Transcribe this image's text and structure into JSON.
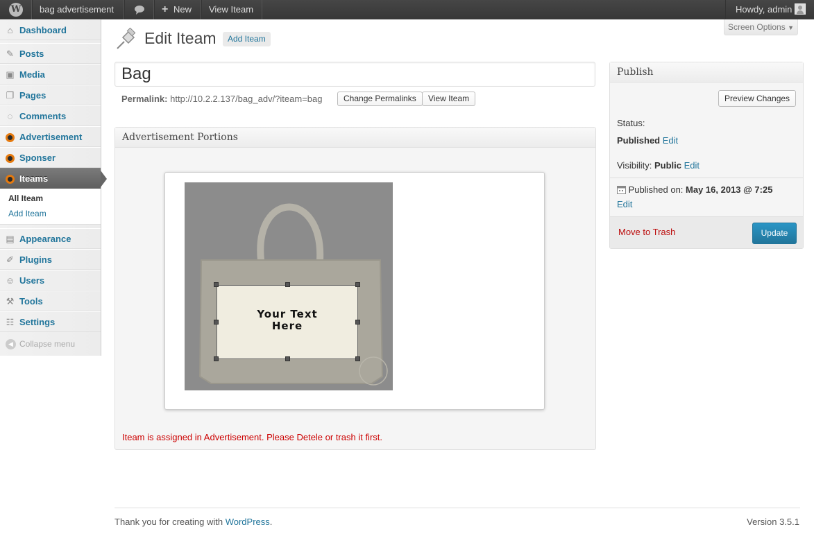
{
  "adminbar": {
    "site_name": "bag advertisement",
    "new_label": "New",
    "view_label": "View Iteam",
    "howdy": "Howdy, admin"
  },
  "sidebar": {
    "items": [
      {
        "label": "Dashboard",
        "icon": "dashboard-icon"
      },
      {
        "label": "Posts",
        "icon": "pin-icon"
      },
      {
        "label": "Media",
        "icon": "media-icon"
      },
      {
        "label": "Pages",
        "icon": "pages-icon"
      },
      {
        "label": "Comments",
        "icon": "comments-icon"
      },
      {
        "label": "Advertisement",
        "icon": "plugin-circle-icon"
      },
      {
        "label": "Sponser",
        "icon": "plugin-circle-icon"
      },
      {
        "label": "Iteams",
        "icon": "plugin-circle-icon"
      },
      {
        "label": "Appearance",
        "icon": "appearance-icon"
      },
      {
        "label": "Plugins",
        "icon": "plugins-icon"
      },
      {
        "label": "Users",
        "icon": "users-icon"
      },
      {
        "label": "Tools",
        "icon": "tools-icon"
      },
      {
        "label": "Settings",
        "icon": "settings-icon"
      }
    ],
    "submenu": [
      "All Iteam",
      "Add Iteam"
    ],
    "collapse": "Collapse menu"
  },
  "screen_options": "Screen Options",
  "page": {
    "title": "Edit Iteam",
    "add_new": "Add Iteam",
    "post_title": "Bag",
    "permalink_label": "Permalink:",
    "permalink_url": "http://10.2.2.137/bag_adv/?iteam=bag",
    "change_permalinks": "Change Permalinks",
    "view_item": "View Iteam"
  },
  "adv_box": {
    "title": "Advertisement Portions",
    "text_line1": "Your Text",
    "text_line2": "Here",
    "error": "Iteam is assigned in Advertisement. Please Detele or trash it first."
  },
  "publish": {
    "title": "Publish",
    "preview": "Preview Changes",
    "status_label": "Status:",
    "status_value": "Published",
    "edit": "Edit",
    "visibility_label": "Visibility:",
    "visibility_value": "Public",
    "published_on_label": "Published on:",
    "published_on_value": "May 16, 2013 @ 7:25",
    "trash": "Move to Trash",
    "update": "Update"
  },
  "footer": {
    "thanks": "Thank you for creating with",
    "wordpress": "WordPress",
    "period": ".",
    "version": "Version 3.5.1"
  }
}
